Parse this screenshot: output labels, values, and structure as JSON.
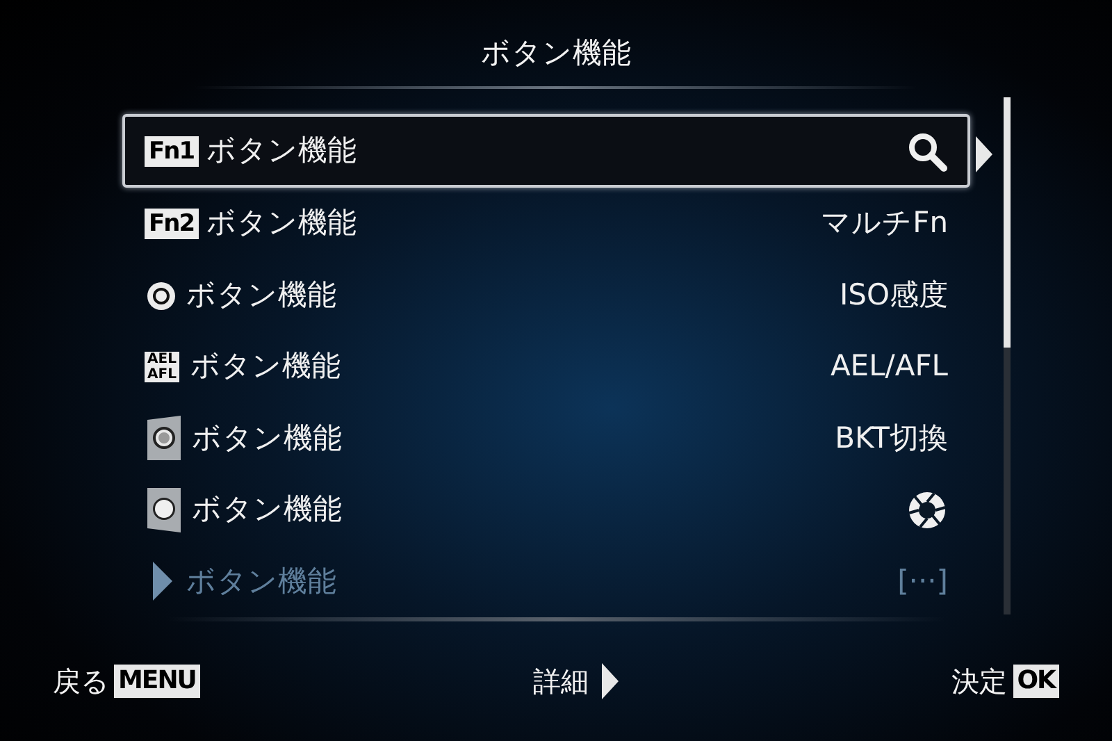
{
  "title": "ボタン機能",
  "rows": [
    {
      "key": {
        "kind": "badge",
        "text": "Fn1"
      },
      "label": "ボタン機能",
      "value": {
        "kind": "search"
      },
      "selected": true,
      "disabled": false
    },
    {
      "key": {
        "kind": "badge",
        "text": "Fn2"
      },
      "label": "ボタン機能",
      "value": {
        "kind": "text",
        "text": "マルチFn"
      },
      "selected": false,
      "disabled": false
    },
    {
      "key": {
        "kind": "ring"
      },
      "label": "ボタン機能",
      "value": {
        "kind": "text",
        "text": "ISO感度"
      },
      "selected": false,
      "disabled": false
    },
    {
      "key": {
        "kind": "stacked",
        "lines": [
          "AEL",
          "AFL"
        ]
      },
      "label": "ボタン機能",
      "value": {
        "kind": "text",
        "text": "AEL/AFL"
      },
      "selected": false,
      "disabled": false
    },
    {
      "key": {
        "kind": "lever-dot"
      },
      "label": "ボタン機能",
      "value": {
        "kind": "text",
        "text": "BKT切換"
      },
      "selected": false,
      "disabled": false
    },
    {
      "key": {
        "kind": "lever"
      },
      "label": "ボタン機能",
      "value": {
        "kind": "aperture"
      },
      "selected": false,
      "disabled": false
    },
    {
      "key": {
        "kind": "arrow"
      },
      "label": "ボタン機能",
      "value": {
        "kind": "text",
        "text": "[···]"
      },
      "selected": false,
      "disabled": true
    }
  ],
  "footer": [
    {
      "label": "戻る",
      "key": "MENU"
    },
    {
      "label": "詳細",
      "arrow": true
    },
    {
      "label": "決定",
      "key": "OK"
    }
  ]
}
